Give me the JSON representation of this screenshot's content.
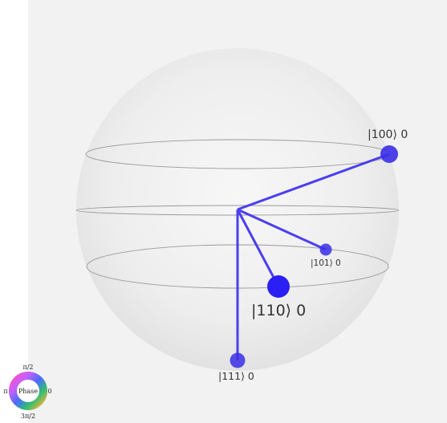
{
  "states": [
    {
      "label": "|100⟩ 0",
      "color": "#3a2fe6"
    },
    {
      "label": "|101⟩ 0",
      "color": "#3a2fe6"
    },
    {
      "label": "|110⟩ 0",
      "color": "#3a2fe6"
    },
    {
      "label": "|111⟩ 0",
      "color": "#3a2fe6"
    }
  ],
  "phase_wheel": {
    "center_label": "Phase",
    "top_label": "π/2",
    "left_label": "π",
    "right_label": "0",
    "bottom_label": "3π/2"
  },
  "colors": {
    "vector": "#4a3ff0",
    "sphere_fill": "#e4e4e4",
    "background": "#f2f2f2"
  }
}
